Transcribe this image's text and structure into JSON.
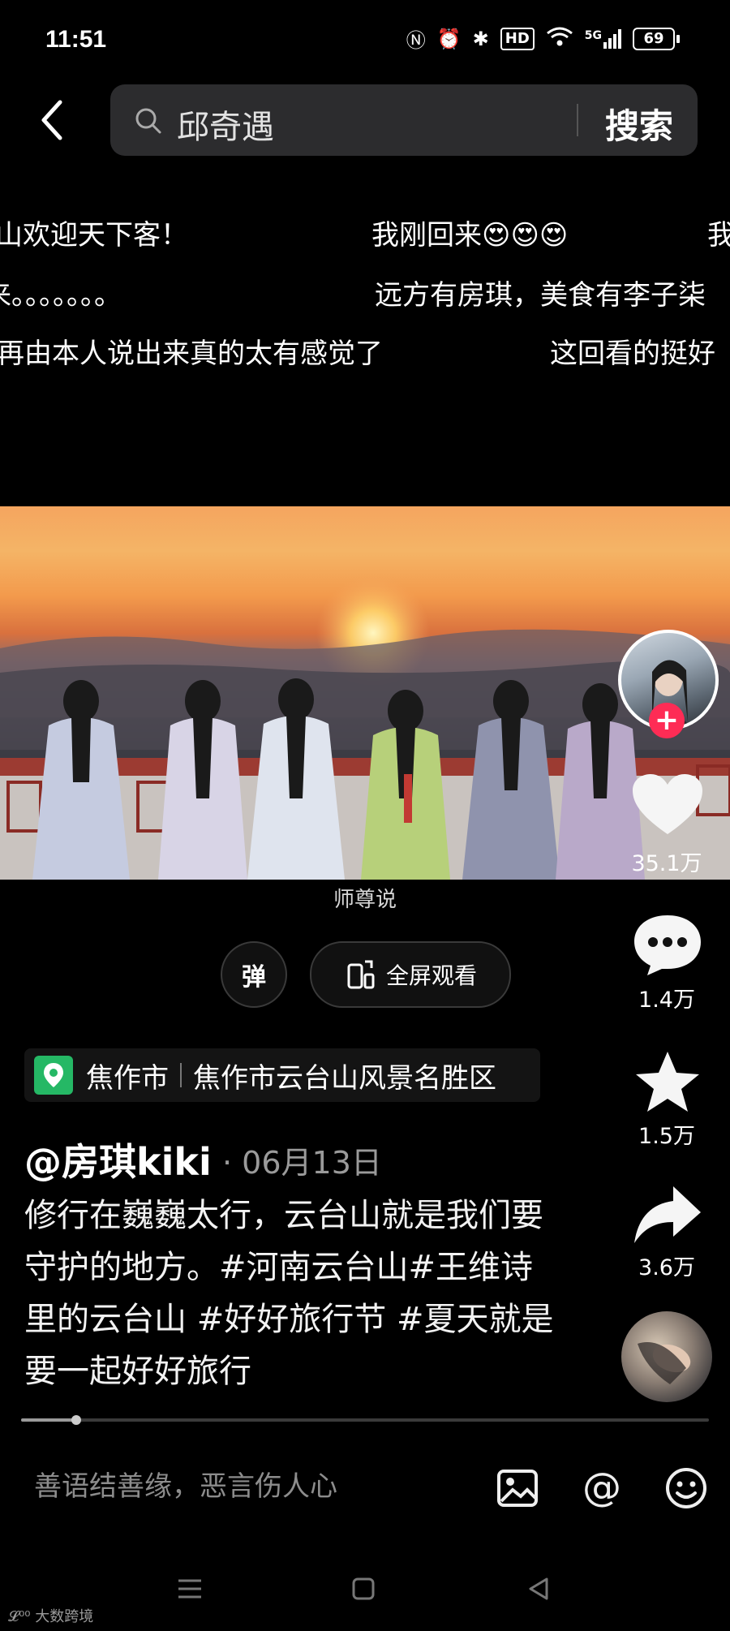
{
  "status_bar": {
    "time": "11:51",
    "network": "5G",
    "hd": "HD",
    "battery": "69"
  },
  "search": {
    "query": "邱奇遇",
    "button": "搜索"
  },
  "danmaku": [
    {
      "text": "山欢迎天下客！"
    },
    {
      "text": "我刚回来😍😍😍"
    },
    {
      "text": "我"
    },
    {
      "text": "来。。。。。。。"
    },
    {
      "text": "远方有房琪，美食有李子柒"
    },
    {
      "text": "再由本人说出来真的太有感觉了"
    },
    {
      "text": "这回看的挺好"
    }
  ],
  "video": {
    "caption": "师尊说"
  },
  "controls": {
    "danmaku_toggle": "弹",
    "fullscreen": "全屏观看"
  },
  "rail": {
    "likes": "35.1万",
    "comments": "1.4万",
    "favorites": "1.5万",
    "shares": "3.6万"
  },
  "location": {
    "city": "焦作市",
    "spot": "焦作市云台山风景名胜区"
  },
  "post": {
    "author": "@房琪kiki",
    "date": "· 06月13日",
    "description": "修行在巍巍太行，云台山就是我们要守护的地方。#河南云台山#王维诗里的云台山 #好好旅行节 #夏天就是要一起好好旅行"
  },
  "playback": {
    "progress": 0.08
  },
  "comment_bar": {
    "placeholder": "善语结善缘，恶言伤人心"
  },
  "watermark": "大数跨境",
  "colors": {
    "accent": "#fe2c55",
    "location_pin": "#25b865",
    "search_bg": "#2c2c2e"
  }
}
